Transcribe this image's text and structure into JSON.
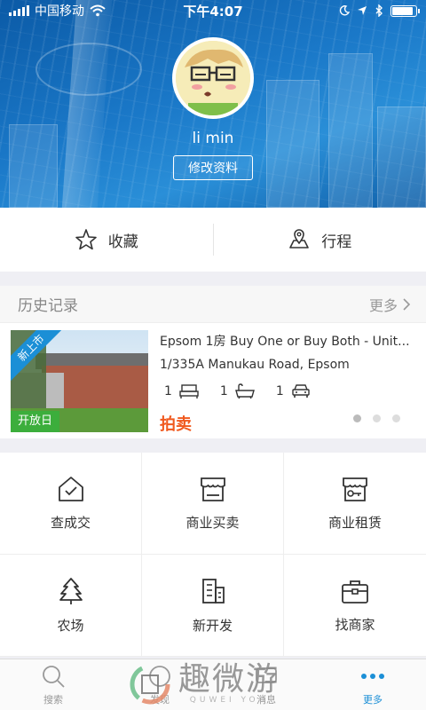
{
  "status_bar": {
    "carrier": "中国移动",
    "time": "下午4:07"
  },
  "profile": {
    "username": "li min",
    "edit_label": "修改资料"
  },
  "quick_actions": [
    {
      "label": "收藏",
      "icon": "star-icon"
    },
    {
      "label": "行程",
      "icon": "map-icon"
    }
  ],
  "history": {
    "title": "历史记录",
    "more_label": "更多",
    "listing": {
      "badge_new": "新上市",
      "badge_open": "开放日",
      "title": "Epsom 1房 Buy One or Buy Both - Unit...",
      "address": "1/335A Manukau Road, Epsom",
      "bedrooms": "1",
      "bathrooms": "1",
      "parking": "1",
      "status": "拍卖"
    },
    "carousel": {
      "total": 3,
      "active_index": 0
    }
  },
  "grid_menu": [
    {
      "label": "查成交",
      "icon": "house-check-icon"
    },
    {
      "label": "商业买卖",
      "icon": "storefront-icon"
    },
    {
      "label": "商业租赁",
      "icon": "shop-key-icon"
    },
    {
      "label": "农场",
      "icon": "tree-icon"
    },
    {
      "label": "新开发",
      "icon": "building-icon"
    },
    {
      "label": "找商家",
      "icon": "briefcase-icon"
    }
  ],
  "tab_bar": [
    {
      "label": "搜索",
      "icon": "search-icon",
      "active": false
    },
    {
      "label": "发现",
      "icon": "discover-icon",
      "active": false
    },
    {
      "label": "消息",
      "icon": "message-icon",
      "active": false
    },
    {
      "label": "更多",
      "icon": "more-dots-icon",
      "active": true
    }
  ],
  "watermark": {
    "text": "趣微游",
    "sub": "QUWEI YOU"
  },
  "colors": {
    "header_blue": "#1a78c8",
    "accent_blue": "#1b8fd6",
    "auction_orange": "#f0591e",
    "open_green": "#3cae3c"
  }
}
